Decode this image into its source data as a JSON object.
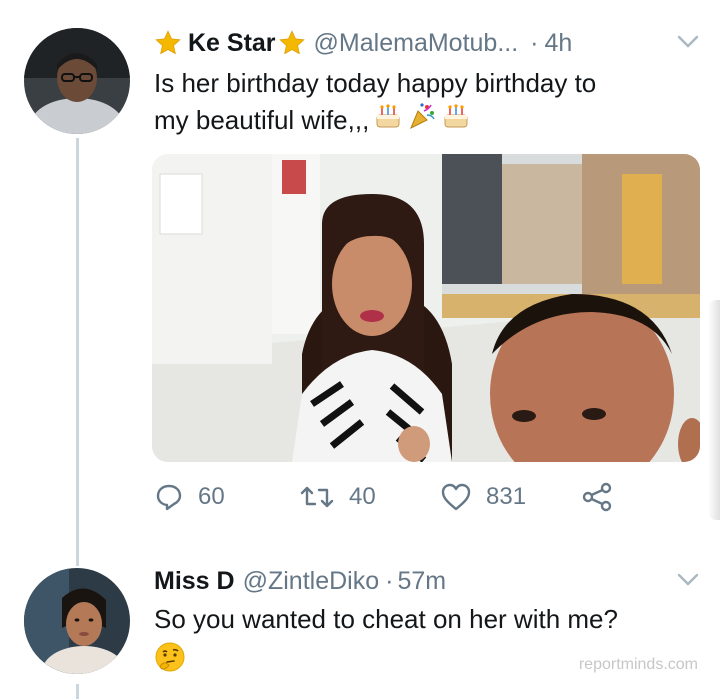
{
  "tweet1": {
    "name": "Ke Star",
    "handle": "@MalemaMotub...",
    "separator": "·",
    "time": "4h",
    "text_line1": "Is her birthday today happy birthday to",
    "text_line2": "my beautiful wife,,,",
    "stats": {
      "replies": "60",
      "retweets": "40",
      "likes": "831"
    }
  },
  "tweet2": {
    "name": "Miss D",
    "handle": "@ZintleDiko",
    "separator": "·",
    "time": "57m",
    "text": "So you wanted to cheat on her with me?"
  },
  "watermark": "reportminds.com",
  "colors": {
    "text": "#14171a",
    "muted": "#657786",
    "thread_line": "#ccd6dd",
    "star": "#f5b800"
  },
  "icons": [
    "star-icon",
    "chevron-down-icon",
    "birthday-cake-icon",
    "party-popper-icon",
    "reply-icon",
    "retweet-icon",
    "like-icon",
    "share-icon",
    "thinking-face-icon"
  ]
}
